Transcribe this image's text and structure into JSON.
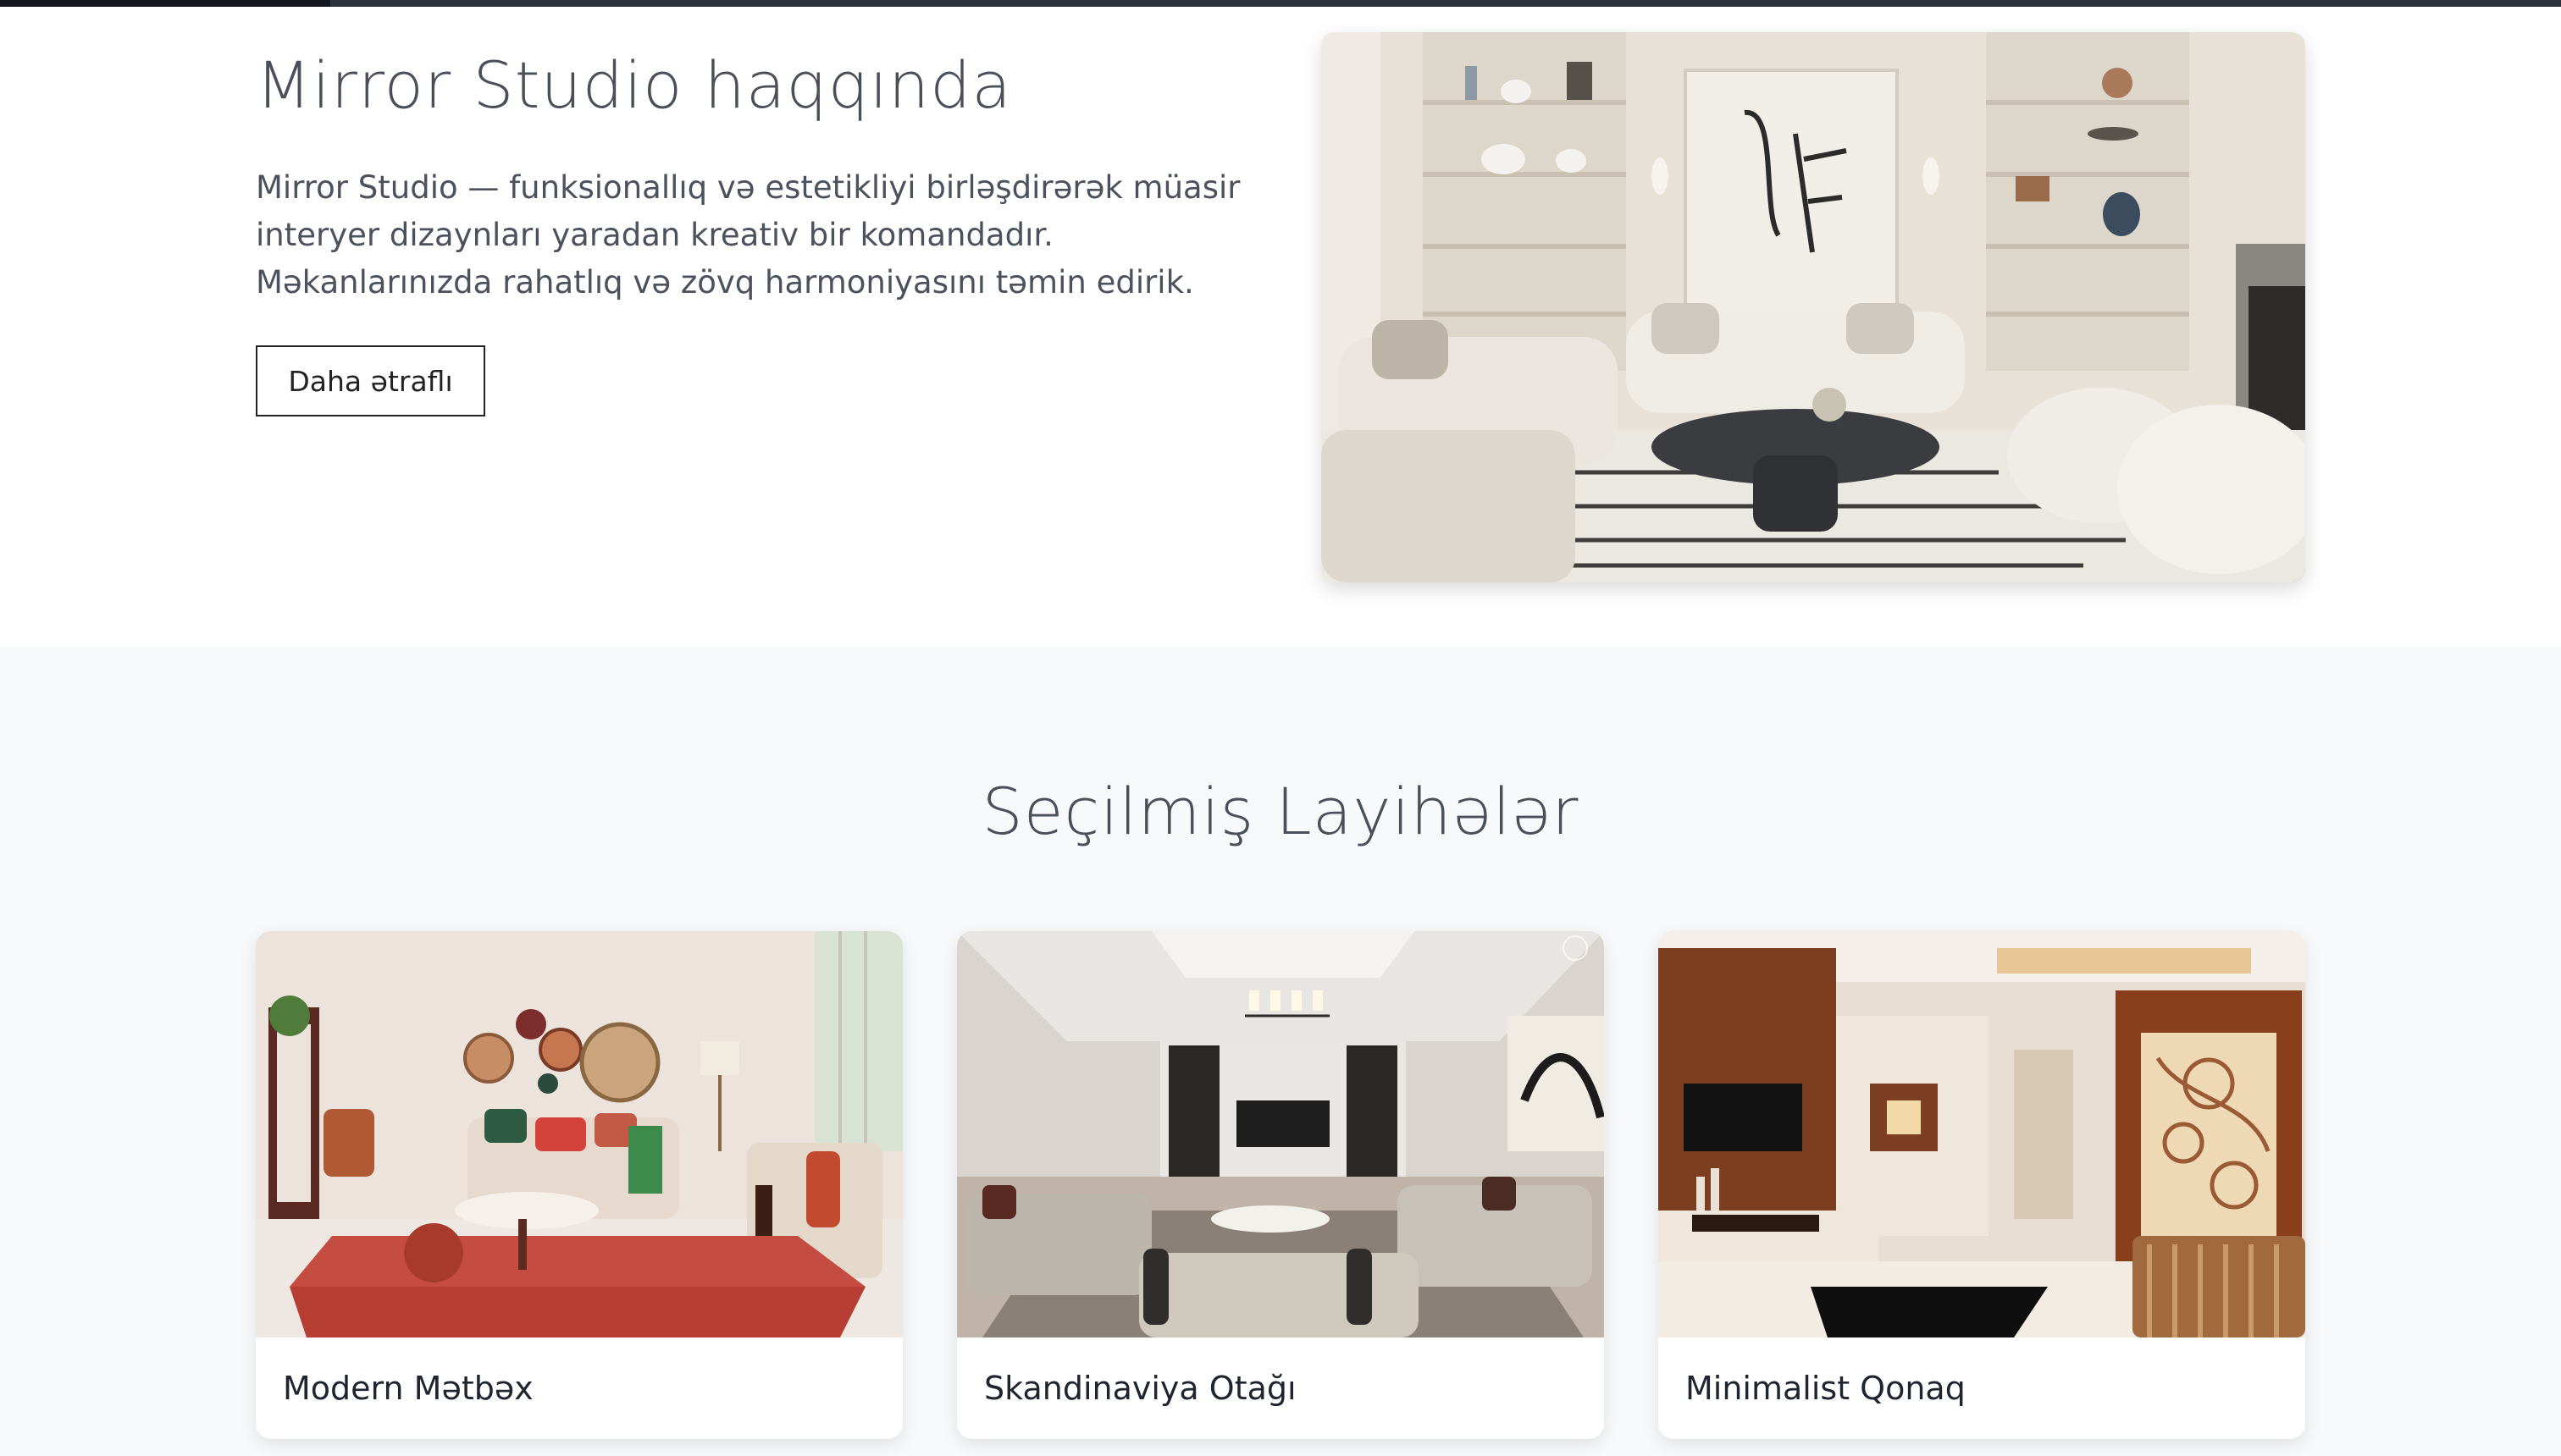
{
  "progress": {
    "fraction": 0.129
  },
  "about": {
    "title": "Mirror Studio haqqında",
    "description": "Mirror Studio — funksionallıq və estetikliyi birləşdirərək müasir interyer dizaynları yaradan kreativ bir komandadır. Məkanlarınızda rahatlıq və zövq harmoniyasını təmin edirik.",
    "button_label": "Daha ətraflı"
  },
  "projects": {
    "title": "Seçilmiş Layihələr",
    "items": [
      {
        "title": "Modern Mətbəx"
      },
      {
        "title": "Skandinaviya Otağı"
      },
      {
        "title": "Minimalist Qonaq"
      }
    ]
  },
  "colors": {
    "accent": "#14171c",
    "section_bg": "#f8f9fb"
  }
}
